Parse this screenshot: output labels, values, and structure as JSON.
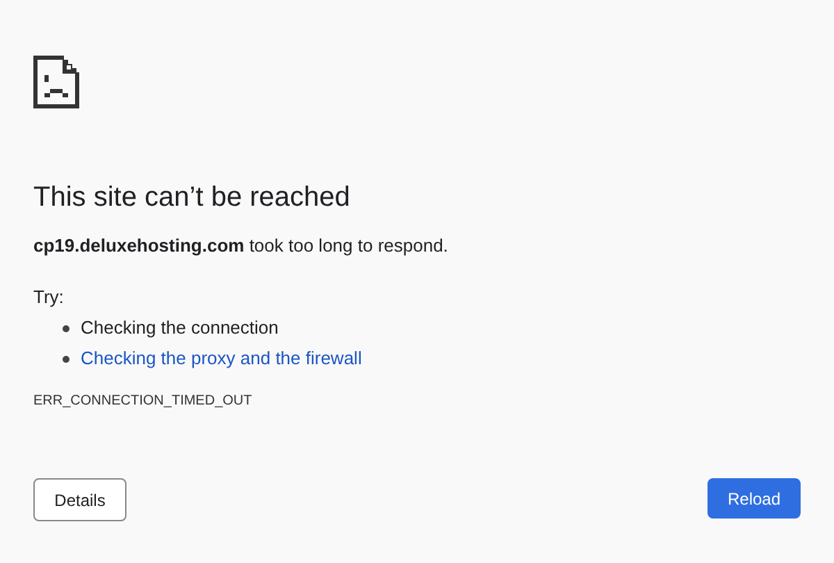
{
  "heading": "This site can’t be reached",
  "message": {
    "host": "cp19.deluxehosting.com",
    "text": "took too long to respond."
  },
  "try_label": "Try:",
  "suggestions": [
    {
      "kind": "text",
      "label": "Checking the connection"
    },
    {
      "kind": "link",
      "label": "Checking the proxy and the firewall"
    }
  ],
  "error_code": "ERR_CONNECTION_TIMED_OUT",
  "buttons": [
    {
      "kind": "secondary",
      "label": "Details"
    },
    {
      "kind": "primary",
      "label": "Reload"
    }
  ]
}
